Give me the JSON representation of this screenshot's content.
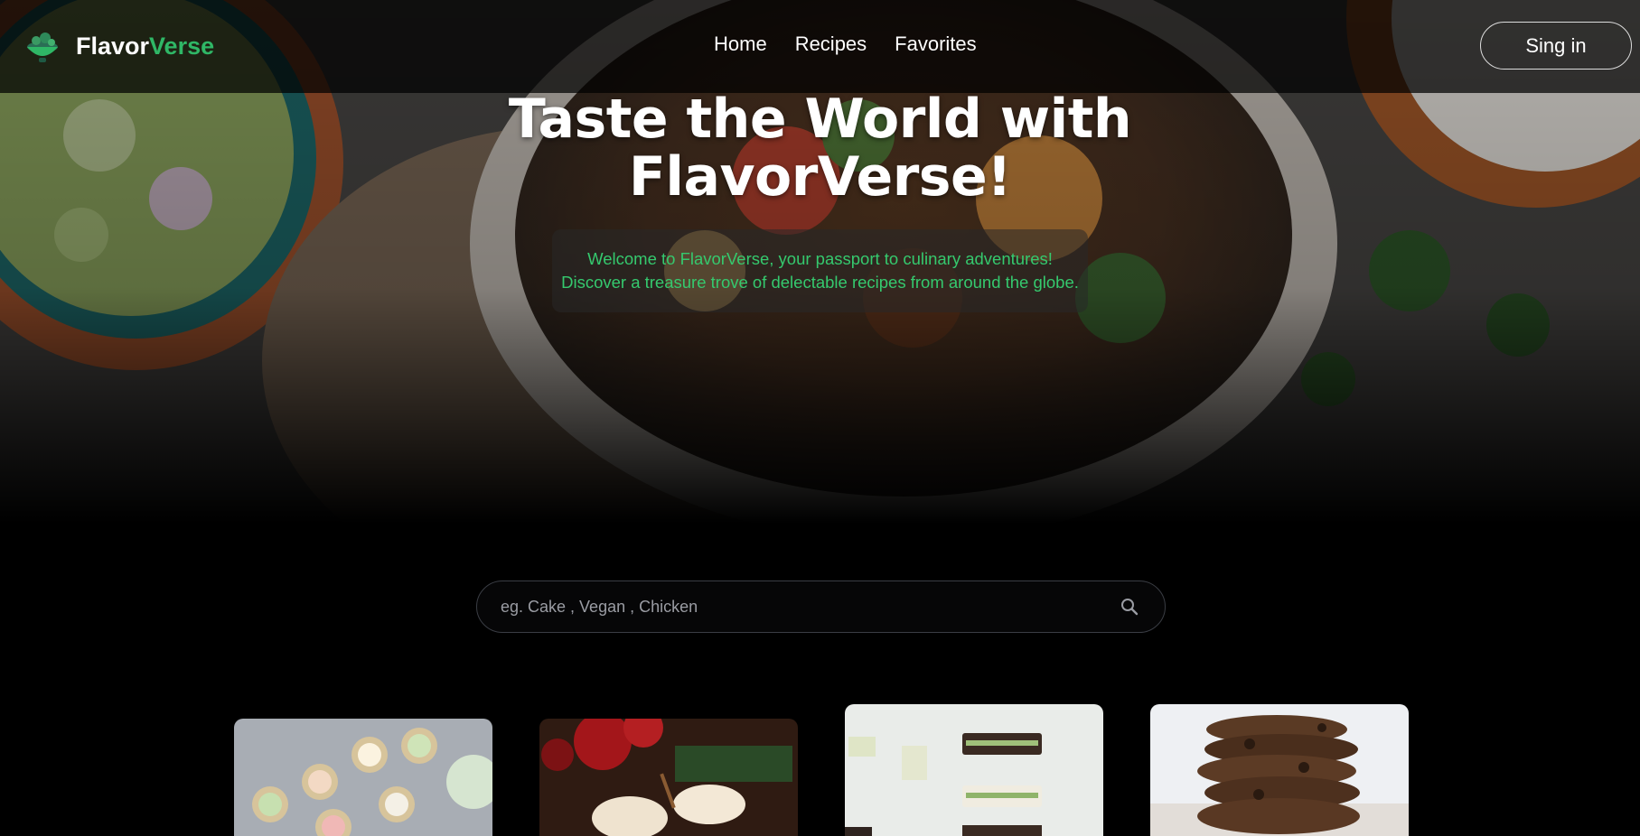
{
  "brand": {
    "name_part1": "Flavor",
    "name_part2": "Verse"
  },
  "nav": {
    "items": [
      {
        "label": "Home"
      },
      {
        "label": "Recipes"
      },
      {
        "label": "Favorites"
      }
    ]
  },
  "auth": {
    "signin_label": "Sing in"
  },
  "hero": {
    "title_line1": "Taste the World with",
    "title_line2": "FlavorVerse!",
    "subtitle_line1": "Welcome to FlavorVerse, your passport to culinary adventures!",
    "subtitle_line2": "Discover a treasure trove of delectable recipes from around the globe."
  },
  "search": {
    "placeholder": "eg. Cake , Vegan , Chicken",
    "value": ""
  },
  "cards": [
    {
      "image": "cupcakes-photo"
    },
    {
      "image": "eggnog-drinks-photo"
    },
    {
      "image": "cucumber-sandwiches-photo"
    },
    {
      "image": "stacked-cookies-photo"
    }
  ],
  "colors": {
    "accent": "#2fb766",
    "subtitle": "#35c96e",
    "background": "#000000"
  }
}
